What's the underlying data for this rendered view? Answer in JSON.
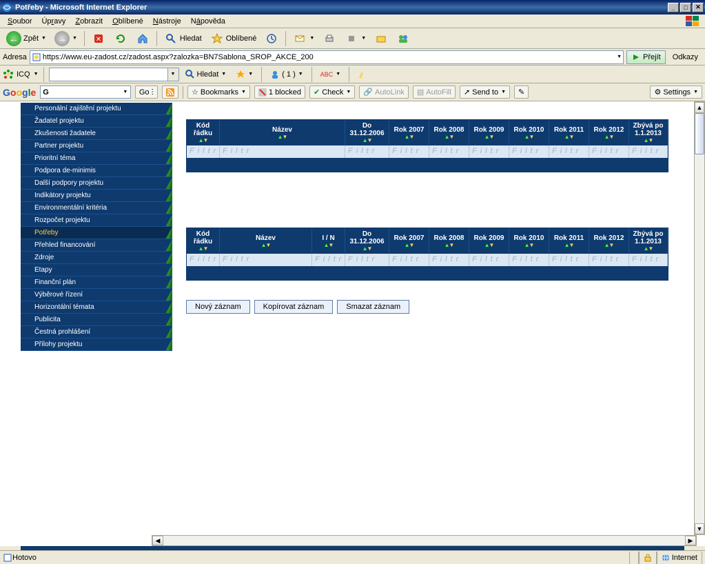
{
  "window": {
    "title": "Potřeby - Microsoft Internet Explorer"
  },
  "menu": {
    "items": [
      {
        "label": "Soubor",
        "u": "S"
      },
      {
        "label": "Úpravy",
        "u": "r"
      },
      {
        "label": "Zobrazit",
        "u": "Z"
      },
      {
        "label": "Oblíbené",
        "u": "O"
      },
      {
        "label": "Nástroje",
        "u": "N"
      },
      {
        "label": "Nápověda",
        "u": "á"
      }
    ]
  },
  "nav": {
    "back_label": "Zpět",
    "search_label": "Hledat",
    "fav_label": "Oblíbené"
  },
  "address": {
    "label": "Adresa",
    "url": "https://www.eu-zadost.cz/zadost.aspx?zalozka=BN7Sablona_SROP_AKCE_200",
    "go_label": "Přejít",
    "links_label": "Odkazy"
  },
  "icq": {
    "label": "ICQ",
    "search_label": "Hledat",
    "count": "( 1 )"
  },
  "google": {
    "go_label": "Go",
    "bookmarks_label": "Bookmarks",
    "blocked_label": "1 blocked",
    "check_label": "Check",
    "autolink_label": "AutoLink",
    "autofill_label": "AutoFill",
    "sendto_label": "Send to",
    "settings_label": "Settings"
  },
  "sidebar": {
    "items": [
      "Personální zajištění projektu",
      "Žadatel projektu",
      "Zkušenosti žadatele",
      "Partner projektu",
      "Prioritní téma",
      "Podpora de-minimis",
      "Další podpory projektu",
      "Indikátory projektu",
      "Environmentální kritéria",
      "Rozpočet projektu",
      "Potřeby",
      "Přehled financování",
      "Zdroje",
      "Etapy",
      "Finanční plán",
      "Výběrové řízení",
      "Horizontální témata",
      "Publicita",
      "Čestná prohlášení",
      "Přílohy projektu"
    ],
    "active_index": 10
  },
  "grids": {
    "filter_text": "Filtr",
    "grid1": {
      "headers": [
        "Kód řádku",
        "Název",
        "Do 31.12.2006",
        "Rok 2007",
        "Rok 2008",
        "Rok 2009",
        "Rok 2010",
        "Rok 2011",
        "Rok 2012",
        "Zbývá po 1.1.2013"
      ]
    },
    "grid2": {
      "headers": [
        "Kód řádku",
        "Název",
        "I / N",
        "Do 31.12.2006",
        "Rok 2007",
        "Rok 2008",
        "Rok 2009",
        "Rok 2010",
        "Rok 2011",
        "Rok 2012",
        "Zbývá po 1.1.2013"
      ]
    }
  },
  "buttons": {
    "new_label": "Nový záznam",
    "copy_label": "Kopírovat záznam",
    "delete_label": "Smazat záznam"
  },
  "status": {
    "done_label": "Hotovo",
    "zone_label": "Internet"
  }
}
